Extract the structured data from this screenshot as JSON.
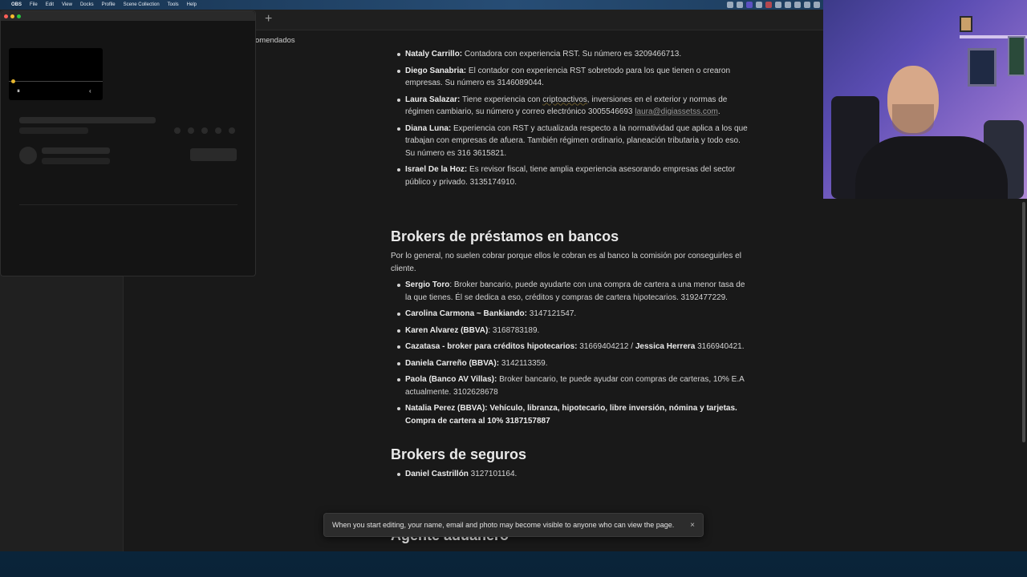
{
  "menubar": {
    "apple": "",
    "items": [
      "OBS",
      "File",
      "Edit",
      "View",
      "Docks",
      "Profile",
      "Scene Collection",
      "Tools",
      "Help"
    ]
  },
  "browser": {
    "new_tab": "+",
    "breadcrumb": "omendados"
  },
  "sections": {
    "contadores": [
      {
        "name": "Nataly Carrillo:",
        "text": " Contadora con experiencia RST. Su número es 3209466713."
      },
      {
        "name": "Diego Sanabria:",
        "text": " El contador con experiencia RST sobretodo para los que tienen o crearon empresas. Su número es 3146089044."
      },
      {
        "name": "Laura Salazar:",
        "text_before": " Tiene experiencia con ",
        "squiggle": "criptoactivos",
        "text_mid": ", inversiones en el exterior y normas de régimen cambiario, su número y correo electrónico 3005546693 ",
        "link": "laura@digiassetss.com",
        "text_after": "."
      },
      {
        "name": "Diana Luna:",
        "text": " Experiencia con RST y actualizada respecto a la normatividad que aplica a los que trabajan con empresas de afuera. También régimen ordinario, planeación tributaria y todo eso. Su número es 316 3615821."
      },
      {
        "name": "Israel De la Hoz:",
        "text": " Es revisor fiscal, tiene amplia experiencia asesorando empresas del sector público y privado. 3135174910."
      }
    ],
    "brokers_bancos": {
      "title": "Brokers de préstamos en bancos",
      "intro": "Por lo general, no suelen cobrar porque ellos le cobran es al banco la comisión por conseguirles el cliente.",
      "items": [
        {
          "name": "Sergio Toro",
          "text": ": Broker bancario, puede ayudarte con una compra de cartera a una menor tasa de la que tienes. Él se dedica a eso, créditos y compras de cartera hipotecarios. 3192477229."
        },
        {
          "name": "Carolina Carmona ~ Bankiando:",
          "text": " 3147121547."
        },
        {
          "name": "Karen Alvarez (BBVA)",
          "text": ": 3168783189."
        },
        {
          "name": "Cazatasa -  broker para créditos hipotecarios:",
          "text": " 31669404212 / ",
          "name2": "Jessica Herrera",
          "text2": " 3166940421."
        },
        {
          "name": "Daniela Carreño (BBVA):",
          "text": " 3142113359."
        },
        {
          "name": "Paola (Banco AV Villas):",
          "text": " Broker bancario, te puede ayudar con compras de carteras, 10% E.A actualmente. 3102628678"
        },
        {
          "name": "Natalia Perez (BBVA):  Vehículo, libranza, hipotecario, libre inversión, nómina y tarjetas. Compra de cartera al 10% 3187157887",
          "text": ""
        }
      ]
    },
    "brokers_seguros": {
      "title": "Brokers de seguros",
      "items": [
        {
          "name": "Daniel Castrillón",
          "text": " 3127101164."
        }
      ]
    },
    "next_heading": "Agente aduanero"
  },
  "toast": {
    "message": "When you start editing, your name, email and photo may become visible to anyone who can view the page.",
    "close": "×"
  },
  "obs": {
    "pause": "⏸",
    "chevron": "‹",
    "preview_dot_color": "#e5b62e"
  }
}
